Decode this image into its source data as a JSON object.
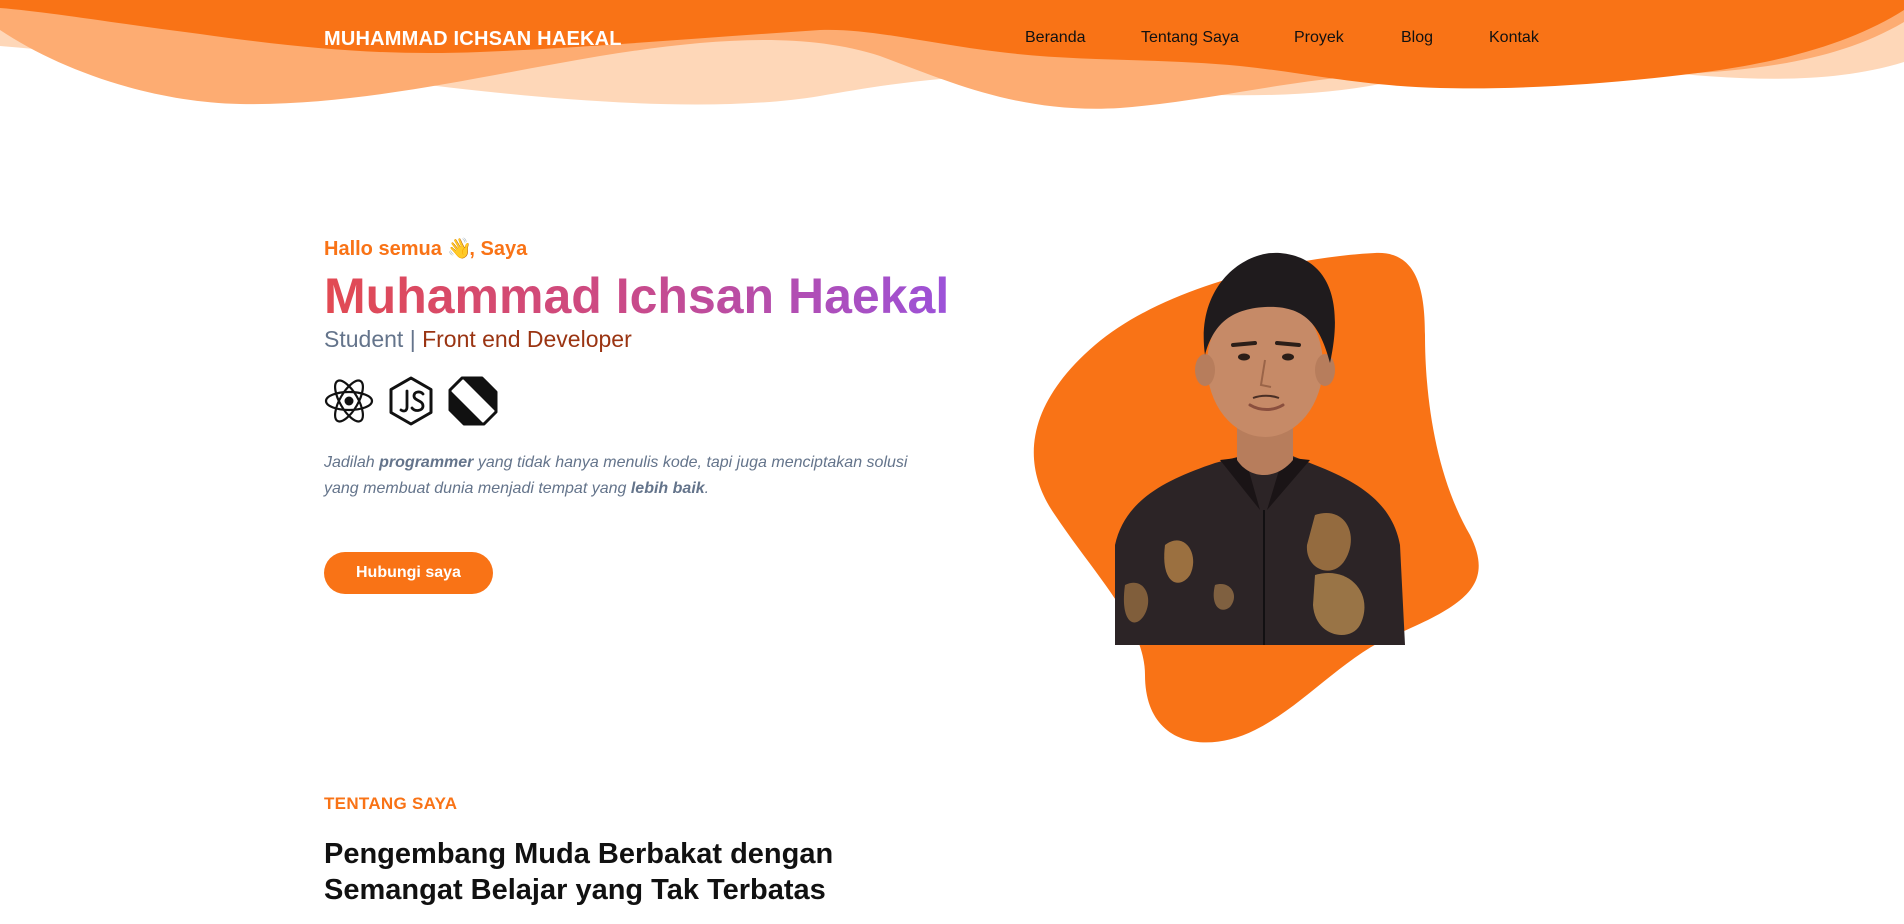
{
  "brand": {
    "name": "MUHAMMAD ICHSAN HAEKAL"
  },
  "nav": {
    "items": [
      {
        "label": "Beranda"
      },
      {
        "label": "Tentang Saya"
      },
      {
        "label": "Proyek"
      },
      {
        "label": "Blog"
      },
      {
        "label": "Kontak"
      }
    ]
  },
  "hero": {
    "greeting_prefix": "Hallo semua",
    "greeting_emoji": "👋",
    "greeting_suffix": ", Saya",
    "name": "Muhammad Ichsan Haekal",
    "role_primary": "Student",
    "role_separator": "|",
    "role_secondary": "Front end Developer",
    "tech_icons": [
      "react-icon",
      "nodejs-icon",
      "dart-icon"
    ],
    "quote_part1": "Jadilah ",
    "quote_bold1": "programmer",
    "quote_part2": " yang tidak hanya menulis kode, tapi juga menciptakan solusi yang membuat dunia menjadi tempat yang ",
    "quote_bold2": "lebih baik",
    "quote_part3": ".",
    "cta_label": "Hubungi saya"
  },
  "about": {
    "eyebrow": "TENTANG SAYA",
    "title": "Pengembang Muda Berbakat dengan Semangat Belajar yang Tak Terbatas"
  },
  "colors": {
    "accent": "#f97316",
    "accent_light": "#fdba8c",
    "accent_pale": "#fed7b8",
    "text_muted": "#64748b",
    "role_secondary": "#9a3412"
  }
}
